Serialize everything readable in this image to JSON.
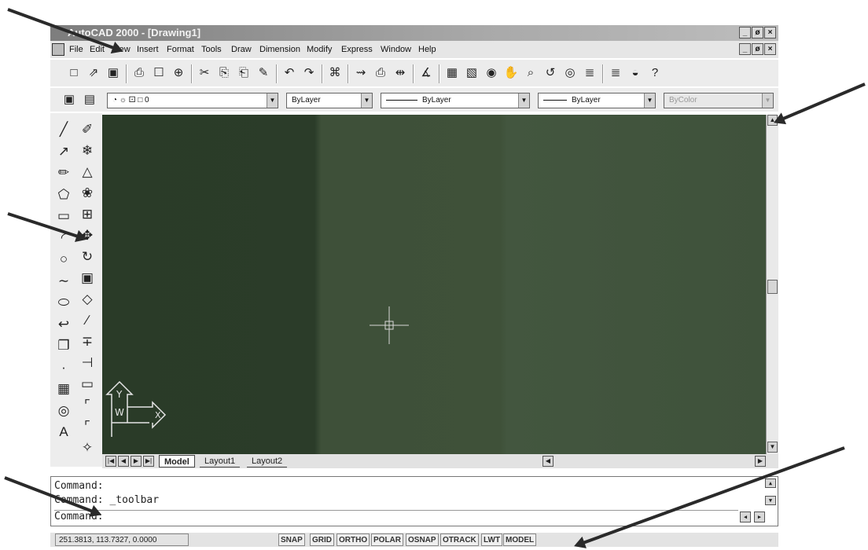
{
  "window": {
    "title": "AutoCAD 2000 - [Drawing1]",
    "caption_buttons": [
      "_",
      "ø",
      "×"
    ],
    "doc_buttons": [
      "_",
      "ø",
      "×"
    ]
  },
  "menu": [
    "File",
    "Edit",
    "View",
    "Insert",
    "Format",
    "Tools",
    "Draw",
    "Dimension",
    "Modify",
    "Express",
    "Window",
    "Help"
  ],
  "standard_toolbar": {
    "icons": [
      "new-icon",
      "open-icon",
      "save-icon",
      "print-icon",
      "print-preview-icon",
      "zoom-realtime-icon",
      "cut-icon",
      "copy-icon",
      "paste-icon",
      "match-properties-icon",
      "undo-icon",
      "redo-icon",
      "hyperlink-icon",
      "tracking-icon",
      "snap-from-icon",
      "distance-icon",
      "ucs-icon",
      "properties-icon",
      "design-center-icon",
      "view-orbit-icon",
      "pan-icon",
      "zoom-window-icon",
      "zoom-previous-icon",
      "zoom-extents-icon",
      "object-props-icon",
      "layer-props-icon",
      "database-icon",
      "help-icon"
    ],
    "glyphs": [
      "□",
      "⇗",
      "▣",
      "⎙",
      "☐",
      "⊕",
      "✂",
      "⎘",
      "⎗",
      "✎",
      "↶",
      "↷",
      "⌘",
      "⇝",
      "⎙",
      "⇹",
      "∡",
      "▦",
      "▧",
      "◉",
      "✋",
      "⌕",
      "↺",
      "◎",
      "≣",
      "≣",
      "◒",
      "?"
    ]
  },
  "properties_toolbar": {
    "layer_value": "◔ ☼ ⚀ □ 0",
    "color_value": "ByLayer",
    "linetype_value": "ByLayer",
    "lineweight_value": "ByLayer",
    "plotstyle_value": "ByColor"
  },
  "left_toolbars": {
    "draw_icons": [
      "line-icon",
      "construction-line-icon",
      "polyline-icon",
      "polygon-icon",
      "rectangle-icon",
      "arc-icon",
      "circle-icon",
      "spline-icon",
      "ellipse-icon",
      "insert-block-icon",
      "make-block-icon",
      "point-icon",
      "hatch-icon",
      "region-icon",
      "text-icon"
    ],
    "draw_glyphs": [
      "╱",
      "↗",
      "✏",
      "⬠",
      "▭",
      "◜",
      "○",
      "∼",
      "⬭",
      "↩",
      "❐",
      "·",
      "▦",
      "◎",
      "A"
    ],
    "modify_icons": [
      "erase-icon",
      "copy-object-icon",
      "mirror-icon",
      "offset-icon",
      "array-icon",
      "move-icon",
      "rotate-icon",
      "scale-icon",
      "stretch-icon",
      "lengthen-icon",
      "trim-icon",
      "extend-icon",
      "break-icon",
      "chamfer-icon",
      "fillet-icon",
      "explode-icon"
    ],
    "modify_glyphs": [
      "✐",
      "❄",
      "△",
      "❀",
      "⊞",
      "✥",
      "↻",
      "▣",
      "◇",
      "∕",
      "∓",
      "⊣",
      "▭",
      "⌜",
      "⌜",
      "✧"
    ]
  },
  "ucs": {
    "y": "Y",
    "w": "W",
    "x": "X"
  },
  "tabs": {
    "nav": [
      "|◀",
      "◀",
      "▶",
      "▶|"
    ],
    "items": [
      "Model",
      "Layout1",
      "Layout2"
    ]
  },
  "command_lines": [
    "Command:",
    "Command:  _toolbar",
    "Command:"
  ],
  "status": {
    "coords": "251.3813, 113.7327, 0.0000",
    "buttons": [
      "SNAP",
      "GRID",
      "ORTHO",
      "POLAR",
      "OSNAP",
      "OTRACK",
      "LWT",
      "MODEL"
    ]
  },
  "colors": {
    "canvas": "#3f5139",
    "frame": "#ececec"
  }
}
